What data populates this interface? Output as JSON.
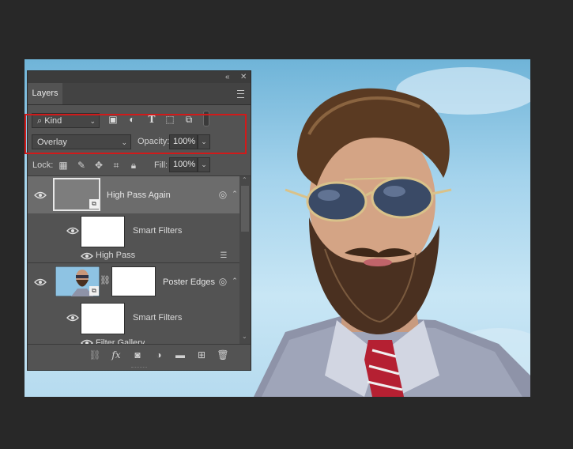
{
  "panel": {
    "tab_label": "Layers",
    "collapse_glyph": "«",
    "close_glyph": "✕",
    "filter": {
      "kind_label": "Kind",
      "search_glyph": "⌕"
    },
    "blend": {
      "mode": "Overlay",
      "opacity_label": "Opacity:",
      "opacity_value": "100%"
    },
    "lock": {
      "label": "Lock:",
      "fill_label": "Fill:",
      "fill_value": "100%"
    },
    "filter_icons": [
      "image-filter-icon",
      "adjustment-filter-icon",
      "type-filter-icon",
      "shape-filter-icon",
      "smartobject-filter-icon"
    ],
    "layers": [
      {
        "name": "High Pass Again",
        "selected": true,
        "sub": {
          "label": "Smart Filters",
          "filter": "High Pass"
        }
      },
      {
        "name": "Poster Edges",
        "selected": false,
        "sub": {
          "label": "Smart Filters",
          "filter": "Filter Gallery"
        }
      }
    ],
    "bottom_icons": [
      "link-layers-icon",
      "fx-icon",
      "add-mask-icon",
      "new-adjustment-icon",
      "new-group-icon",
      "new-layer-icon",
      "delete-icon"
    ],
    "fx_label": "fx"
  },
  "colors": {
    "highlight": "#d11a1a",
    "panel_bg": "#535353",
    "selected_row": "#6c6c6c"
  }
}
